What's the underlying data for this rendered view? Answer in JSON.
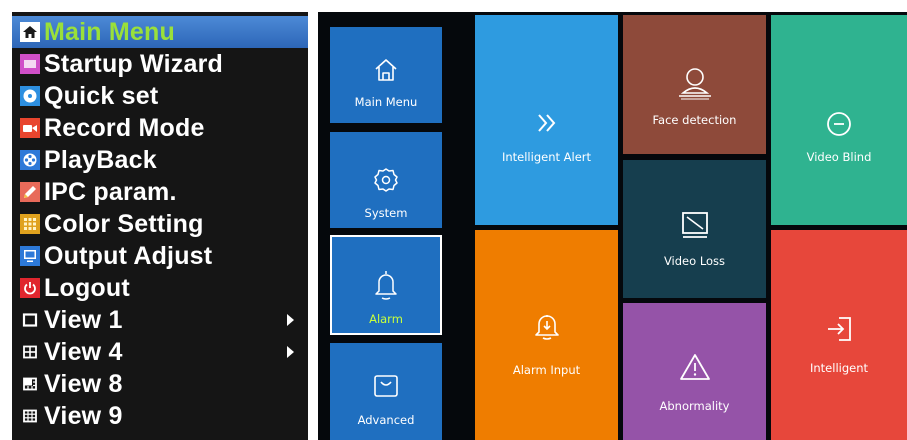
{
  "menu": {
    "items": [
      {
        "label": "Main Menu",
        "icon": "home-icon",
        "selected": true
      },
      {
        "label": "Startup Wizard",
        "icon": "wizard-icon"
      },
      {
        "label": "Quick set",
        "icon": "disc-icon"
      },
      {
        "label": "Record Mode",
        "icon": "camera-icon"
      },
      {
        "label": "PlayBack",
        "icon": "film-reel-icon"
      },
      {
        "label": "IPC param.",
        "icon": "pencil-icon"
      },
      {
        "label": "Color Setting",
        "icon": "grid-icon"
      },
      {
        "label": "Output Adjust",
        "icon": "monitor-icon"
      },
      {
        "label": "Logout",
        "icon": "power-icon"
      },
      {
        "label": "View 1",
        "icon": "single-view-icon",
        "submenu": true
      },
      {
        "label": "View 4",
        "icon": "quad-view-icon",
        "submenu": true
      },
      {
        "label": "View 8",
        "icon": "eight-view-icon"
      },
      {
        "label": "View 9",
        "icon": "nine-view-icon"
      }
    ]
  },
  "nav": {
    "main_menu": "Main Menu",
    "system": "System",
    "alarm": "Alarm",
    "advanced": "Advanced"
  },
  "tiles": {
    "intelligent_alert": "Intelligent Alert",
    "face_detection": "Face detection",
    "video_blind": "Video Blind",
    "video_loss": "Video Loss",
    "alarm_input": "Alarm Input",
    "abnormality": "Abnormality",
    "intelligent": "Intelligent"
  },
  "colors": {
    "menu_bg": "#151515",
    "menu_selected": "#2d66b8",
    "selected_text": "#9ae03a",
    "nav_blue": "#1f6fc0",
    "tile_blue": "#2e9be0",
    "tile_brown": "#8e4a3a",
    "tile_teal_green": "#2fb390",
    "tile_dark_teal": "#163e4e",
    "tile_orange": "#ef7d00",
    "tile_purple": "#9553a8",
    "tile_red": "#e7473b"
  }
}
